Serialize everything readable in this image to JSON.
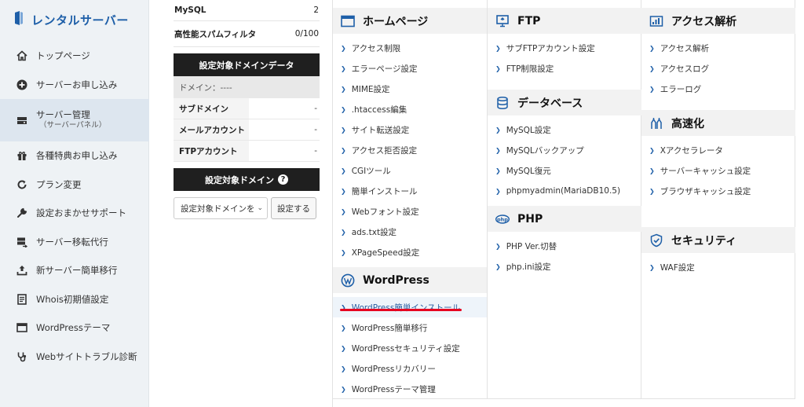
{
  "brand": {
    "title": "レンタルサーバー"
  },
  "sidebar": {
    "items": [
      {
        "label": "トップページ",
        "icon": "home-icon"
      },
      {
        "label": "サーバーお申し込み",
        "icon": "plus-circle-icon"
      },
      {
        "label": "サーバー管理",
        "sub": "（サーバーパネル）",
        "icon": "server-drive-icon"
      },
      {
        "label": "各種特典お申し込み",
        "icon": "gift-icon"
      },
      {
        "label": "プラン変更",
        "icon": "refresh-icon"
      },
      {
        "label": "設定おまかせサポート",
        "icon": "wrench-icon"
      },
      {
        "label": "サーバー移転代行",
        "icon": "server-transfer-icon"
      },
      {
        "label": "新サーバー簡単移行",
        "icon": "upload-icon"
      },
      {
        "label": "Whois初期値設定",
        "icon": "document-icon"
      },
      {
        "label": "WordPressテーマ",
        "icon": "window-icon"
      },
      {
        "label": "Webサイトトラブル診断",
        "icon": "stethoscope-icon"
      }
    ]
  },
  "info": {
    "usage": [
      {
        "key": "MySQL",
        "value": "2"
      },
      {
        "key": "高性能スパムフィルタ",
        "value": "0/100"
      }
    ],
    "domain_data_header": "設定対象ドメインデータ",
    "domain_line": "ドメイン：----",
    "domain_rows": [
      {
        "key": "サブドメイン",
        "value": "-"
      },
      {
        "key": "メールアカウント",
        "value": "-"
      },
      {
        "key": "FTPアカウント",
        "value": "-"
      }
    ],
    "target_domain_header": "設定対象ドメイン",
    "target_select_value": "設定対象ドメインを",
    "set_button": "設定する"
  },
  "sections": {
    "homepage": {
      "title": "ホームページ",
      "links": [
        "アクセス制限",
        "エラーページ設定",
        "MIME設定",
        ".htaccess編集",
        "サイト転送設定",
        "アクセス拒否設定",
        "CGIツール",
        "簡単インストール",
        "Webフォント設定",
        "ads.txt設定",
        "XPageSpeed設定"
      ]
    },
    "wordpress": {
      "title": "WordPress",
      "links": [
        "WordPress簡単インストール",
        "WordPress簡単移行",
        "WordPressセキュリティ設定",
        "WordPressリカバリー",
        "WordPressテーマ管理"
      ]
    },
    "ftp": {
      "title": "FTP",
      "links": [
        "サブFTPアカウント設定",
        "FTP制限設定"
      ]
    },
    "database": {
      "title": "データベース",
      "links": [
        "MySQL設定",
        "MySQLバックアップ",
        "MySQL復元",
        "phpmyadmin(MariaDB10.5)"
      ]
    },
    "php": {
      "title": "PHP",
      "icon_text": "php",
      "links": [
        "PHP Ver.切替",
        "php.ini設定"
      ]
    },
    "analytics": {
      "title": "アクセス解析",
      "links": [
        "アクセス解析",
        "アクセスログ",
        "エラーログ"
      ]
    },
    "speed": {
      "title": "高速化",
      "links": [
        "Xアクセラレータ",
        "サーバーキャッシュ設定",
        "ブラウザキャッシュ設定"
      ]
    },
    "security": {
      "title": "セキュリティ",
      "links": [
        "WAF設定"
      ]
    }
  },
  "colors": {
    "brand_blue": "#1e5fa8",
    "highlight_red": "#e60020",
    "dark_header": "#1f1f1f"
  }
}
